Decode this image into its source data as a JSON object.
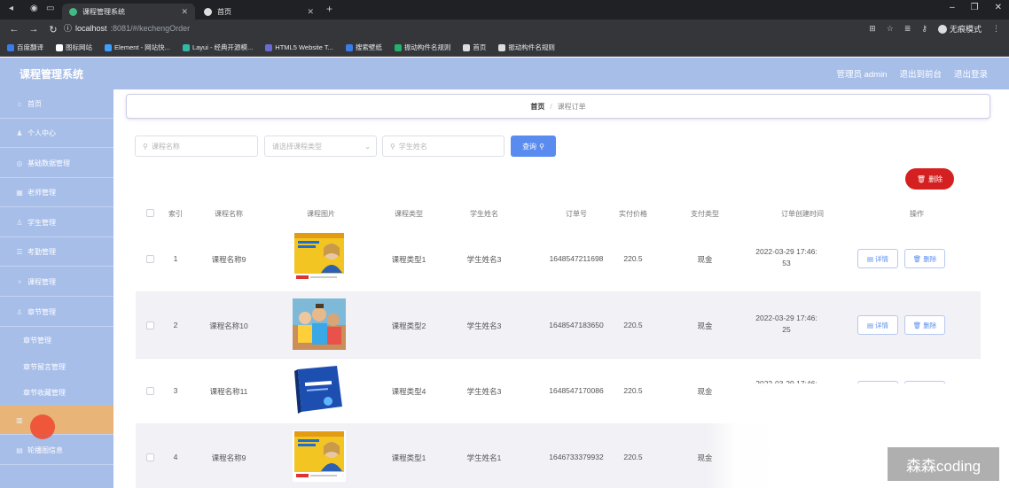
{
  "browser": {
    "tabs": [
      {
        "title": "课程管理系统",
        "active": true
      },
      {
        "title": "首页",
        "active": false
      }
    ],
    "url_host": "localhost",
    "url_path": ":8081/#/kechengOrder",
    "incognito_label": "无痕模式",
    "bookmarks": [
      {
        "label": "百度翻译",
        "color": "#3b7ce8"
      },
      {
        "label": "图标网站",
        "color": "#ffffff"
      },
      {
        "label": "Element - 网站快...",
        "color": "#409eff"
      },
      {
        "label": "Layui - 经典开源模...",
        "color": "#2fb9a6"
      },
      {
        "label": "HTML5 Website T...",
        "color": "#6b6bd6"
      },
      {
        "label": "搜索壁纸",
        "color": "#3b7ce8"
      },
      {
        "label": "振动构件名规则",
        "color": "#23b26d"
      },
      {
        "label": "首页",
        "color": "#dddddd"
      },
      {
        "label": "振动构件名规则",
        "color": "#dddddd"
      }
    ]
  },
  "header": {
    "title": "课程管理系统",
    "links": [
      "管理员 admin",
      "退出到前台",
      "退出登录"
    ]
  },
  "sidebar": {
    "items": [
      {
        "label": "首页",
        "icon": "home-icon",
        "glyph": "⌂"
      },
      {
        "label": "个人中心",
        "icon": "user-icon",
        "glyph": "♟"
      },
      {
        "label": "基础数据管理",
        "icon": "data-icon",
        "glyph": "◎"
      },
      {
        "label": "老师管理",
        "icon": "teacher-icon",
        "glyph": "▦"
      },
      {
        "label": "学生管理",
        "icon": "student-icon",
        "glyph": "♙"
      },
      {
        "label": "考勤管理",
        "icon": "attendance-icon",
        "glyph": "☰"
      },
      {
        "label": "课程管理",
        "icon": "course-icon",
        "glyph": "♆"
      },
      {
        "label": "章节管理",
        "icon": "chapter-icon",
        "glyph": "♙"
      }
    ],
    "subitems": [
      "章节管理",
      "章节留言管理",
      "章节收藏管理"
    ],
    "bottom_items": [
      {
        "label": "",
        "icon": "chart-icon",
        "glyph": "▥",
        "active": true
      },
      {
        "label": "轮播图信息",
        "icon": "carousel-icon",
        "glyph": "▤",
        "active": false
      }
    ]
  },
  "breadcrumb": {
    "home": "首页",
    "separator": "/",
    "current": "课程订单"
  },
  "search": {
    "course_name_placeholder": "课程名称",
    "course_type_placeholder": "请选择课程类型",
    "student_name_placeholder": "学生姓名",
    "search_button": "查询"
  },
  "delete_button": "删除",
  "table": {
    "headers": [
      "索引",
      "课程名称",
      "课程图片",
      "课程类型",
      "学生姓名",
      "订单号",
      "实付价格",
      "支付类型",
      "订单创建时间",
      "操作"
    ],
    "rows": [
      {
        "index": "1",
        "course": "课程名称9",
        "type": "课程类型1",
        "student": "学生姓名3",
        "order": "1648547211698",
        "price": "220.5",
        "pay": "现金",
        "time": "2022-03-29 17:46:\n53",
        "img": "book-yellow"
      },
      {
        "index": "2",
        "course": "课程名称10",
        "type": "课程类型2",
        "student": "学生姓名3",
        "order": "1648547183650",
        "price": "220.5",
        "pay": "现金",
        "time": "2022-03-29 17:46:\n25",
        "img": "kids"
      },
      {
        "index": "3",
        "course": "课程名称11",
        "type": "课程类型4",
        "student": "学生姓名3",
        "order": "1648547170086",
        "price": "220.5",
        "pay": "现金",
        "time": "2022-03-29 17:46:",
        "img": "book-blue"
      },
      {
        "index": "4",
        "course": "课程名称9",
        "type": "课程类型1",
        "student": "学生姓名1",
        "order": "1646733379932",
        "price": "220.5",
        "pay": "现金",
        "time": "",
        "img": "book-yellow"
      }
    ],
    "detail_label": "详情",
    "delete_label": "删除"
  },
  "watermark": "森森coding"
}
